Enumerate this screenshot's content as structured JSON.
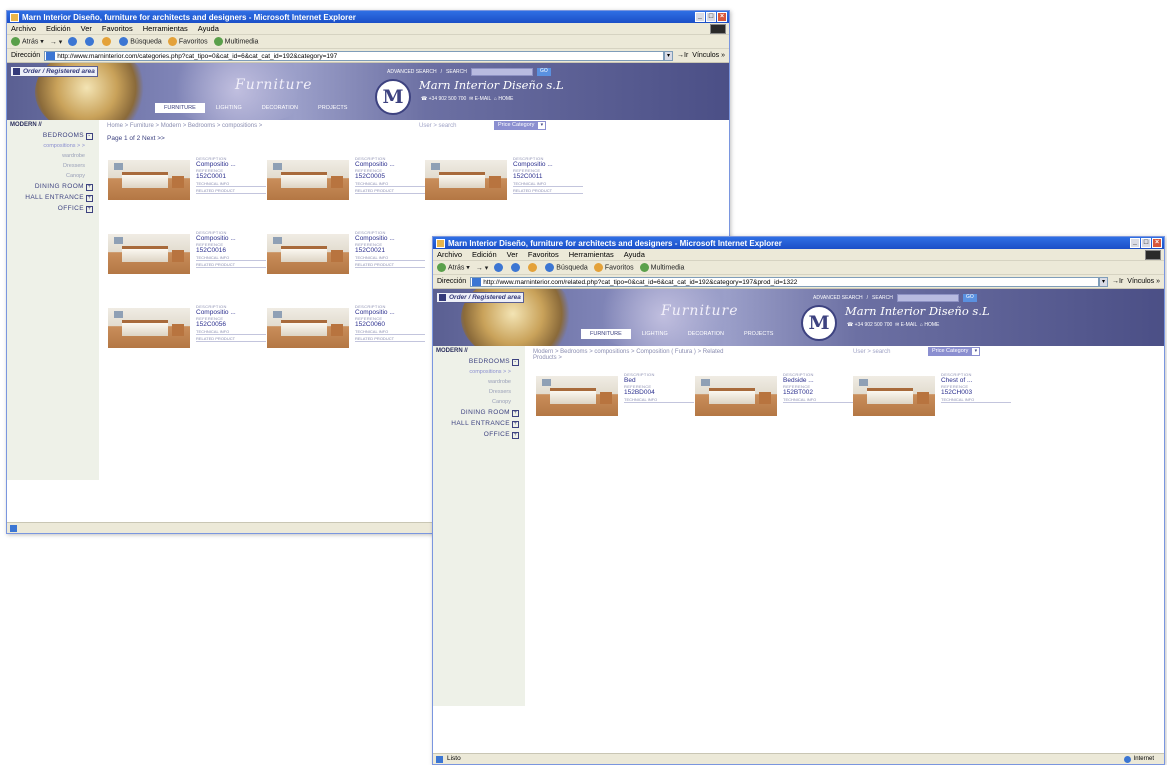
{
  "colors": {
    "titlebar": "#1b4fc7",
    "banner": "#5a5f92",
    "link": "#2b2f8e",
    "sidebar_bg": "#eef1e8",
    "accent": "#8b8fd0"
  },
  "browser": {
    "menu": [
      "Archivo",
      "Edición",
      "Ver",
      "Favoritos",
      "Herramientas",
      "Ayuda"
    ],
    "toolbar": {
      "back": "Atrás",
      "search": "Búsqueda",
      "favorites": "Favoritos",
      "multimedia": "Multimedia"
    },
    "address_label": "Dirección",
    "go_label": "Ir",
    "links_label": "Vínculos",
    "status_ready": "Listo",
    "status_zone": "Internet"
  },
  "site": {
    "order_label": "Order / Registered area",
    "advanced_search": "ADVANCED SEARCH",
    "search_label": "SEARCH",
    "search_go": "GO",
    "script_title": "Furniture",
    "tabs": [
      "FURNITURE",
      "LIGHTING",
      "DECORATION",
      "PROJECTS"
    ],
    "monogram": "M",
    "company": "Marn Interior Diseño s.L",
    "phone": "+34 902 500 700",
    "email": "E-MAIL",
    "home": "HOME",
    "user_search": "User > search",
    "price_category": "Price Category",
    "sidebar": {
      "root": "MODERN //",
      "bedrooms": "BEDROOMS",
      "subs": [
        "compositions > >",
        "wardrobe",
        "Dressers",
        "Canopy"
      ],
      "dining": "DINING ROOM",
      "hall": "HALL ENTRANCE",
      "office": "OFFICE"
    },
    "labels": {
      "description": "DESCRIPTION",
      "reference": "REFERENCE",
      "technical": "TECHNICAL INFO",
      "related": "RELATED PRODUCT"
    }
  },
  "window1": {
    "title": "Marn Interior Diseño, furniture for architects and designers - Microsoft Internet Explorer",
    "url": "http://www.marninterior.com/categories.php?cat_tipo=0&cat_id=6&cat_cat_id=192&category=197",
    "breadcrumb": "Home > Furniture > Modern > Bedrooms > compositions >",
    "pager": "Page 1 of 2   Next >>",
    "products": [
      {
        "desc": "Compositio ...",
        "ref": "152C0001"
      },
      {
        "desc": "Compositio ...",
        "ref": "152C0005"
      },
      {
        "desc": "Compositio ...",
        "ref": "152C0011"
      },
      {
        "desc": "Compositio ...",
        "ref": "152C0016"
      },
      {
        "desc": "Compositio ...",
        "ref": "152C0021"
      },
      {
        "desc": "Compositio ...",
        "ref": "152C0056"
      },
      {
        "desc": "Compositio ...",
        "ref": "152C0060"
      }
    ]
  },
  "window2": {
    "title": "Marn Interior Diseño, furniture for architects and designers - Microsoft Internet Explorer",
    "url": "http://www.marninterior.com/related.php?cat_tipo=0&cat_id=6&cat_cat_id=192&category=197&prod_id=1322",
    "breadcrumb_1": "Modern > Bedrooms > compositions > Composition ( Futura ) > Related",
    "breadcrumb_2": "Products >",
    "products": [
      {
        "desc": "Bed",
        "ref": "152BD004"
      },
      {
        "desc": "Bedside ...",
        "ref": "152BT002"
      },
      {
        "desc": "Chest of ...",
        "ref": "152CH003"
      }
    ]
  }
}
